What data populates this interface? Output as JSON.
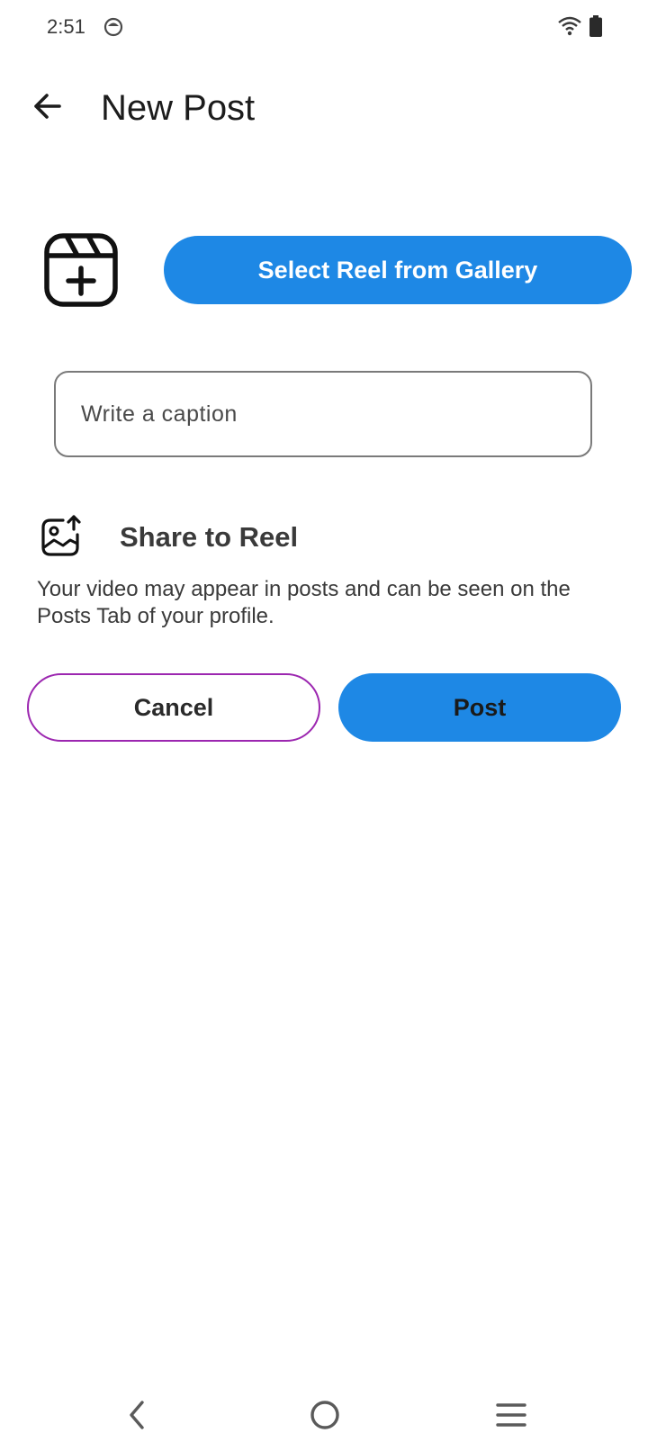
{
  "status_bar": {
    "time": "2:51",
    "icons": [
      "app-notification-icon",
      "wifi-icon",
      "battery-icon"
    ]
  },
  "header": {
    "title": "New Post",
    "back_icon": "arrow-left-icon"
  },
  "reel_picker": {
    "icon": "reel-add-icon",
    "button_label": "Select Reel from Gallery"
  },
  "caption": {
    "placeholder": "Write a caption",
    "value": ""
  },
  "share": {
    "icon": "image-upload-icon",
    "title": "Share to Reel",
    "description": "Your video may appear in posts and can be seen on the Posts Tab of your profile."
  },
  "actions": {
    "cancel_label": "Cancel",
    "post_label": "Post"
  },
  "colors": {
    "primary": "#1e88e5",
    "cancel_border": "#9c27b0",
    "text": "#3a3a3a"
  },
  "nav_bar": {
    "icons": [
      "nav-back-icon",
      "nav-home-icon",
      "nav-menu-icon"
    ]
  }
}
